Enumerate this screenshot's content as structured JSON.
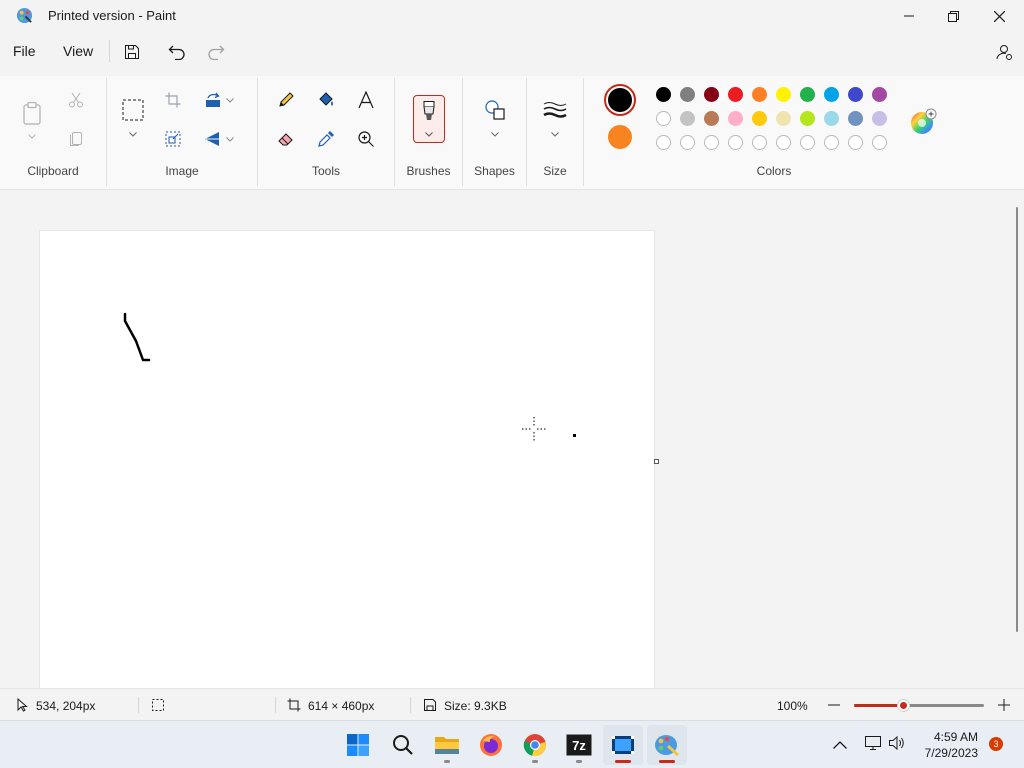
{
  "window": {
    "title": "Printed version - Paint",
    "minimize_icon": "minimize-icon",
    "maximize_icon": "restore-icon",
    "close_icon": "close-icon"
  },
  "menu": {
    "file": "File",
    "view": "View",
    "save_icon": "save-icon",
    "undo_icon": "undo-icon",
    "redo_icon": "redo-icon",
    "share_icon": "account-settings-icon"
  },
  "ribbon": {
    "groups": {
      "clipboard": "Clipboard",
      "image": "Image",
      "tools": "Tools",
      "brushes": "Brushes",
      "shapes": "Shapes",
      "size": "Size",
      "colors": "Colors"
    },
    "primary_color": "#000000",
    "secondary_color": "#f7841e",
    "palette": [
      [
        "#000000",
        "#7f7f7f",
        "#880015",
        "#ed1c24",
        "#ff7f27",
        "#fff200",
        "#22b14c",
        "#00a2e8",
        "#3f48cc",
        "#a349a4"
      ],
      [
        "#ffffff",
        "#c3c3c3",
        "#b97a57",
        "#ffaec9",
        "#ffc90e",
        "#efe4b0",
        "#b5e61d",
        "#99d9ea",
        "#7092be",
        "#c8bfe7"
      ]
    ]
  },
  "status": {
    "cursor_pos": "534, 204px",
    "canvas_size": "614 × 460px",
    "file_size": "Size: 9.3KB",
    "zoom": "100%",
    "zoom_level": 0.38
  },
  "taskbar": {
    "time": "4:59 AM",
    "date": "7/29/2023",
    "notifications": "3",
    "apps": [
      "start-icon",
      "search-icon",
      "file-explorer-icon",
      "firefox-icon",
      "chrome-icon",
      "7zip-icon",
      "video-editor-icon",
      "paint-icon"
    ]
  },
  "colors": {
    "accent": "#c42b1c",
    "taskbar_bg": "#e9eef4"
  }
}
